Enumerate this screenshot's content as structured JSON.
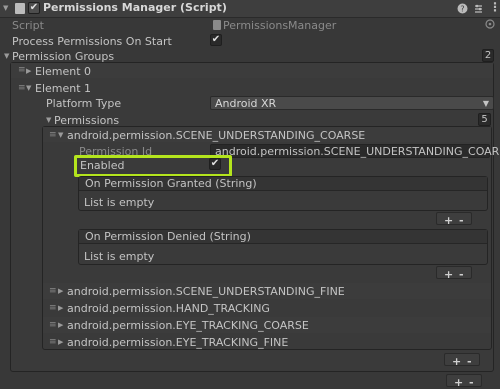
{
  "header": {
    "title": "Permissions Manager (Script)",
    "enabled_check": "✔"
  },
  "fields": {
    "script_label": "Script",
    "script_value": "PermissionsManager",
    "process_label": "Process Permissions On Start",
    "process_check": "✔",
    "groups_label": "Permission Groups",
    "groups_count": "2"
  },
  "elements": {
    "e0_label": "Element 0",
    "e1_label": "Element 1",
    "platform_label": "Platform Type",
    "platform_value": "Android XR",
    "permissions_label": "Permissions",
    "permissions_count": "5"
  },
  "expanded_permission": {
    "name": "android.permission.SCENE_UNDERSTANDING_COARSE",
    "id_label": "Permission Id",
    "id_value": "android.permission.SCENE_UNDERSTANDING_COARSE",
    "enabled_label": "Enabled",
    "enabled_check": "✔",
    "granted_header": "On Permission Granted (String)",
    "granted_empty": "List is empty",
    "denied_header": "On Permission Denied (String)",
    "denied_empty": "List is empty"
  },
  "collapsed_permissions": [
    "android.permission.SCENE_UNDERSTANDING_FINE",
    "android.permission.HAND_TRACKING",
    "android.permission.EYE_TRACKING_COARSE",
    "android.permission.EYE_TRACKING_FINE"
  ],
  "buttons": {
    "plus": "+",
    "minus": "-"
  },
  "colors": {
    "highlight": "#b4e51d",
    "background": "#383838"
  }
}
